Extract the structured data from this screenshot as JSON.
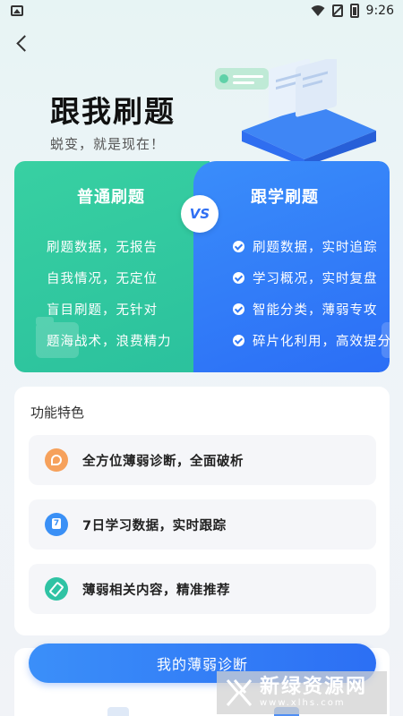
{
  "status_bar": {
    "time": "9:26"
  },
  "hero": {
    "title": "跟我刷题",
    "subtitle": "蜕变，就是现在！"
  },
  "compare": {
    "left": {
      "title": "普通刷题",
      "items": [
        "刷题数据，无报告",
        "自我情况，无定位",
        "盲目刷题，无针对",
        "题海战术，浪费精力"
      ]
    },
    "vs": "VS",
    "right": {
      "title": "跟学刷题",
      "items": [
        "刷题数据，实时追踪",
        "学习概况，实时复盘",
        "智能分类，薄弱专攻",
        "碎片化利用，高效提分"
      ]
    }
  },
  "features": {
    "title": "功能特色",
    "items": [
      {
        "label": "全方位薄弱诊断，全面破析",
        "icon": "diagnosis-icon",
        "color": "#f6a15c"
      },
      {
        "label": "7日学习数据，实时跟踪",
        "icon": "calendar-icon",
        "color": "#3a90f6"
      },
      {
        "label": "薄弱相关内容，精准推荐",
        "icon": "edit-icon",
        "color": "#2fc3a4"
      }
    ]
  },
  "cta": {
    "label": "我的薄弱诊断"
  },
  "watermark": {
    "cn": "新绿资源网",
    "en": "www.xlhs.com"
  },
  "colors": {
    "green": "#2bc19d",
    "blue": "#2f6ff3"
  }
}
